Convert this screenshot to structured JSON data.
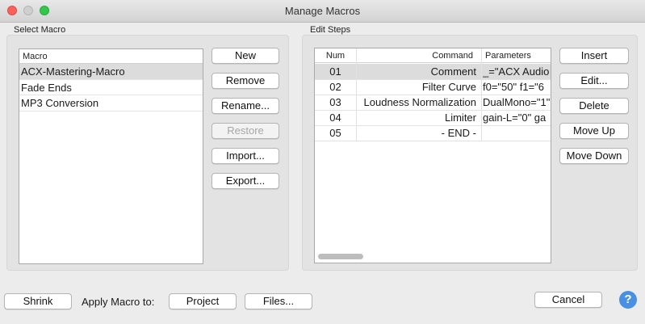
{
  "window": {
    "title": "Manage Macros"
  },
  "select_macro": {
    "group_label": "Select Macro",
    "column_header": "Macro",
    "items": [
      {
        "label": "ACX-Mastering-Macro",
        "selected": true
      },
      {
        "label": "Fade Ends",
        "selected": false
      },
      {
        "label": "MP3 Conversion",
        "selected": false
      }
    ],
    "buttons": {
      "new": "New",
      "remove": "Remove",
      "rename": "Rename...",
      "restore": "Restore",
      "import": "Import...",
      "export": "Export..."
    }
  },
  "edit_steps": {
    "group_label": "Edit Steps",
    "columns": {
      "num": "Num",
      "command": "Command",
      "parameters": "Parameters"
    },
    "rows": [
      {
        "num": "01",
        "command": "Comment",
        "parameters": "_=\"ACX Audio",
        "selected": true
      },
      {
        "num": "02",
        "command": "Filter Curve",
        "parameters": "f0=\"50\" f1=\"6",
        "selected": false
      },
      {
        "num": "03",
        "command": "Loudness Normalization",
        "parameters": "DualMono=\"1\"",
        "selected": false
      },
      {
        "num": "04",
        "command": "Limiter",
        "parameters": "gain-L=\"0\" ga",
        "selected": false
      },
      {
        "num": "05",
        "command": "- END -",
        "parameters": "",
        "selected": false
      }
    ],
    "buttons": {
      "insert": "Insert",
      "edit": "Edit...",
      "delete": "Delete",
      "move_up": "Move Up",
      "move_down": "Move Down"
    }
  },
  "footer": {
    "shrink": "Shrink",
    "apply_label": "Apply Macro to:",
    "project": "Project",
    "files": "Files...",
    "cancel": "Cancel",
    "help_glyph": "?"
  },
  "colors": {
    "selection": "#dcdcdc",
    "help_accent": "#4a90e2"
  },
  "icons": [
    "close-icon",
    "minimize-icon",
    "maximize-icon",
    "help-icon"
  ]
}
